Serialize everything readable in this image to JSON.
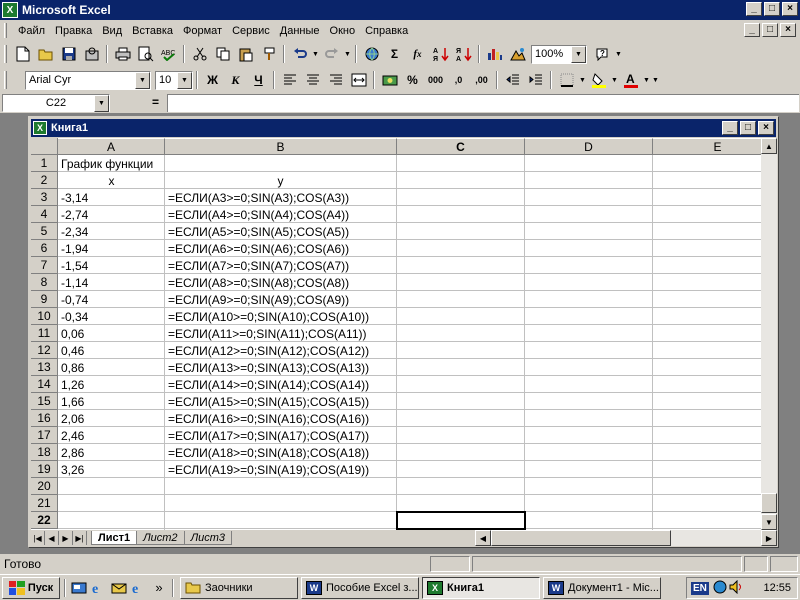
{
  "app": {
    "title": "Microsoft Excel",
    "icon_letter": "X",
    "caption_min": "_",
    "caption_max": "□",
    "caption_close": "×"
  },
  "menu": [
    "Файл",
    "Правка",
    "Вид",
    "Вставка",
    "Формат",
    "Сервис",
    "Данные",
    "Окно",
    "Справка"
  ],
  "toolbar1": {
    "zoom": "100%"
  },
  "toolbar2": {
    "font_name": "Arial Cyr",
    "font_size": "10",
    "bold_label": "Ж",
    "italic_label": "К",
    "underline_label": "Ч",
    "percent_label": "%",
    "thousands_label": "000",
    "inc_decimal_label": ",0",
    "dec_decimal_label": ",00"
  },
  "formula_bar": {
    "name_box": "C22",
    "equals": "=",
    "value": ""
  },
  "workbook": {
    "title": "Книга1",
    "icon_letter": "X"
  },
  "columns": [
    "A",
    "B",
    "C",
    "D",
    "E"
  ],
  "selected_column": "C",
  "rows": [
    "1",
    "2",
    "3",
    "4",
    "5",
    "6",
    "7",
    "8",
    "9",
    "10",
    "11",
    "12",
    "13",
    "14",
    "15",
    "16",
    "17",
    "18",
    "19",
    "20",
    "21",
    "22"
  ],
  "selected_row": "22",
  "cells": {
    "A1": "График функции",
    "A2": "x",
    "B2": "y",
    "A": [
      "-3,14",
      "-2,74",
      "-2,34",
      "-1,94",
      "-1,54",
      "-1,14",
      "-0,74",
      "-0,34",
      "0,06",
      "0,46",
      "0,86",
      "1,26",
      "1,66",
      "2,06",
      "2,46",
      "2,86",
      "3,26"
    ],
    "B": [
      "=ЕСЛИ(A3>=0;SIN(A3);COS(A3))",
      "=ЕСЛИ(A4>=0;SIN(A4);COS(A4))",
      "=ЕСЛИ(A5>=0;SIN(A5);COS(A5))",
      "=ЕСЛИ(A6>=0;SIN(A6);COS(A6))",
      "=ЕСЛИ(A7>=0;SIN(A7);COS(A7))",
      "=ЕСЛИ(A8>=0;SIN(A8);COS(A8))",
      "=ЕСЛИ(A9>=0;SIN(A9);COS(A9))",
      "=ЕСЛИ(A10>=0;SIN(A10);COS(A10))",
      "=ЕСЛИ(A11>=0;SIN(A11);COS(A11))",
      "=ЕСЛИ(A12>=0;SIN(A12);COS(A12))",
      "=ЕСЛИ(A13>=0;SIN(A13);COS(A13))",
      "=ЕСЛИ(A14>=0;SIN(A14);COS(A14))",
      "=ЕСЛИ(A15>=0;SIN(A15);COS(A15))",
      "=ЕСЛИ(A16>=0;SIN(A16);COS(A16))",
      "=ЕСЛИ(A17>=0;SIN(A17);COS(A17))",
      "=ЕСЛИ(A18>=0;SIN(A18);COS(A18))",
      "=ЕСЛИ(A19>=0;SIN(A19);COS(A19))"
    ]
  },
  "sheets": [
    "Лист1",
    "Лист2",
    "Лист3"
  ],
  "active_sheet": "Лист1",
  "status": "Готово",
  "taskbar": {
    "start_label": "Пуск",
    "more_label": "»",
    "tasks": [
      {
        "label": "Заочники",
        "icon": "folder-icon"
      },
      {
        "label": "Пособие Excel з...",
        "icon": "word-icon"
      },
      {
        "label": "Книга1",
        "icon": "excel-icon",
        "active": true
      },
      {
        "label": "Документ1 - Mic...",
        "icon": "word-icon"
      }
    ],
    "lang": "EN",
    "clock": "12:55"
  },
  "colors": {
    "title_bar": "#0a246a",
    "face": "#d4d0c8",
    "excel_green": "#1e7a2e"
  }
}
